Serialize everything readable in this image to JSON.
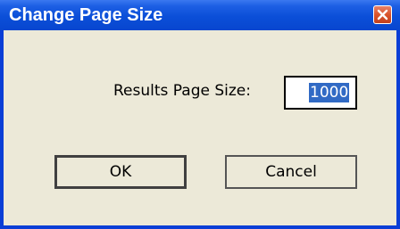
{
  "dialog": {
    "title": "Change Page Size",
    "close_icon": "close-icon",
    "label": "Results Page Size:",
    "page_size_value": "1000",
    "ok_label": "OK",
    "cancel_label": "Cancel"
  },
  "colors": {
    "titlebar": "#0b4fd8",
    "close_button": "#d9532a",
    "client_background": "#ece9d8",
    "selection_highlight": "#316ac5"
  }
}
